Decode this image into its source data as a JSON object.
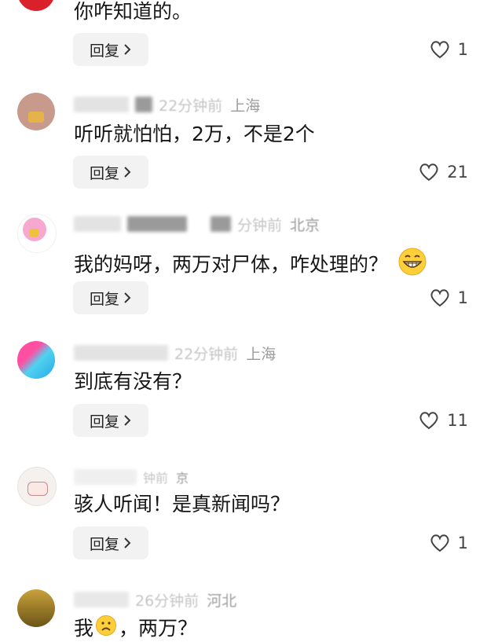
{
  "reply_label": "回复",
  "comments": [
    {
      "meta_ghost": "",
      "location": "",
      "text": "你咋知道的。",
      "likes": "1"
    },
    {
      "meta_ghost": "22分钟前",
      "location": "上海",
      "text": "听听就怕怕，2万，不是2个",
      "likes": "21"
    },
    {
      "meta_ghost": "分钟前",
      "location": "北京",
      "text": "我的妈呀，两万对尸体，咋处理的？",
      "likes": "1"
    },
    {
      "meta_ghost": "22分钟前",
      "location": "上海",
      "text": "到底有没有？",
      "likes": "11"
    },
    {
      "meta_ghost": "钟前",
      "location": "京",
      "text": "骇人听闻！是真新闻吗？",
      "likes": "1"
    },
    {
      "meta_ghost": "26分钟前",
      "location": "河北",
      "text_a": "我",
      "text_b": "，两万？"
    }
  ],
  "icons": {
    "heart": "heart-outline-icon",
    "chevron": "chevron-right-icon",
    "grin_emoji": "grinning-emoji",
    "sad_emoji": "frowning-emoji"
  },
  "colors": {
    "reply_bg": "#f2f2f2",
    "meta_text": "#b3b3b3",
    "body_text": "#161616"
  }
}
